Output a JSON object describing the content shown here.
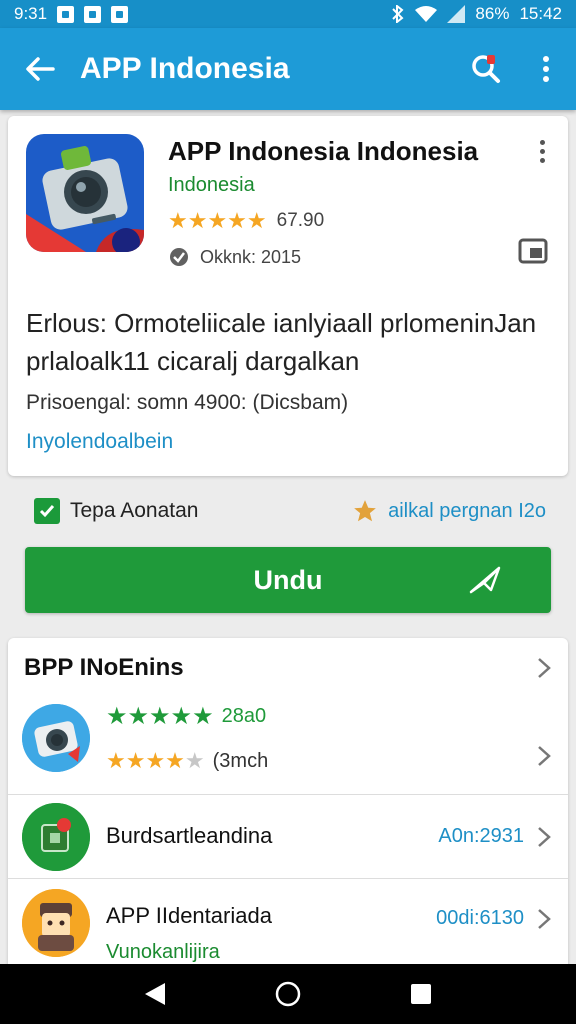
{
  "status_bar": {
    "time_left": "9:31",
    "battery": "86%",
    "clock": "15:42"
  },
  "app_bar": {
    "title": "APP Indonesia"
  },
  "app_detail": {
    "name": "APP Indonesia Indonesia",
    "developer": "Indonesia",
    "stars": "★★★★★",
    "rating_count": "67.90",
    "installs": "Okknk: 2015",
    "description": "Erlous: Ormoteliicale ianlyiaall prlomeninJan prlaloalk11 cicaralj dargalkan",
    "price_line": "Prisoengal: somn 4900: (Dicsbam)",
    "more_link": "Inyolendoalbein"
  },
  "options": {
    "checkbox_label": "Tepa Aonatan",
    "star_label": "ailkal pergnan I2o"
  },
  "download": {
    "label": "Undu"
  },
  "related": {
    "header": "BPP INoEnins",
    "rows": [
      {
        "stars_green": "★★★★★",
        "count_green": "28a0",
        "stars_orange": "★★★★",
        "star_grey": "★",
        "count": "(3mch"
      },
      {
        "title": "Burdsartleandina",
        "meta": "A0n:2931"
      },
      {
        "title": "APP IIdentariada",
        "meta": "00di:6130",
        "subtitle": "Vunokanlijira"
      }
    ]
  },
  "colors": {
    "primary": "#1e9bd7",
    "status": "#178fc8",
    "green": "#1f9a3a",
    "star": "#f5a623",
    "link": "#1e8fc6"
  }
}
